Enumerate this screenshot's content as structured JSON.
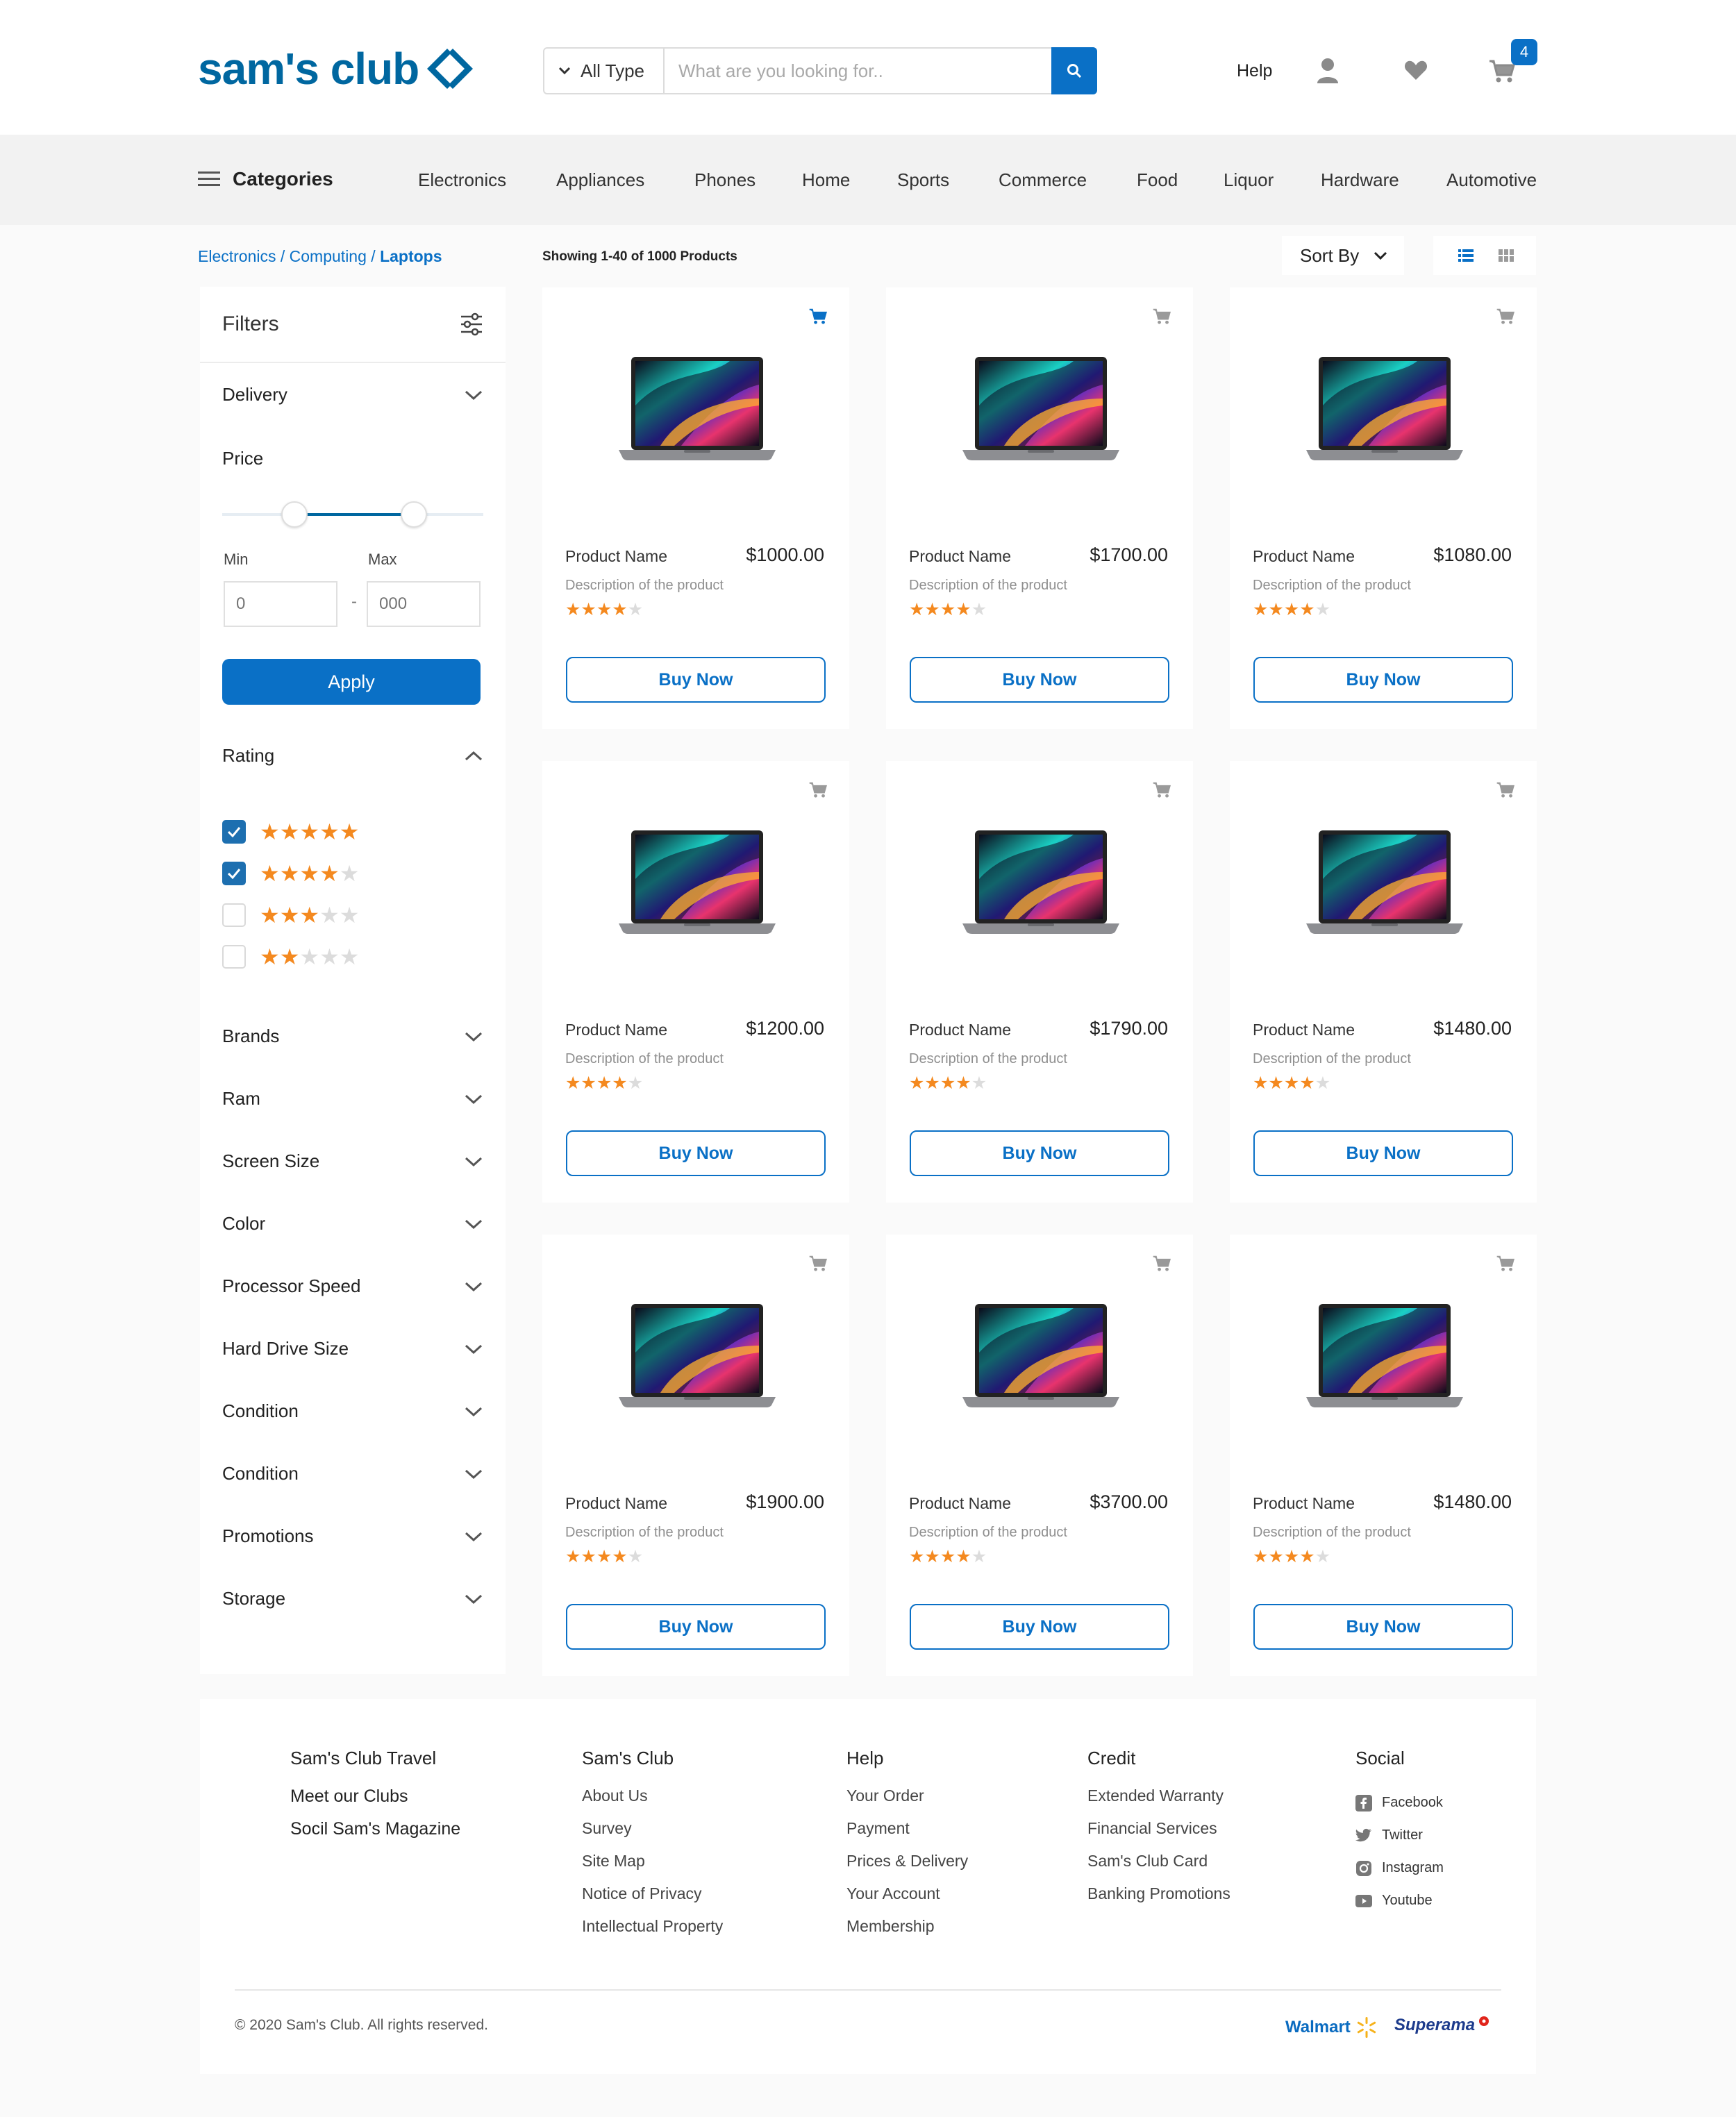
{
  "header": {
    "logo_text": "sam's club",
    "search_type": "All Type",
    "search_placeholder": "What are you looking for..",
    "help": "Help",
    "cart_count": "4"
  },
  "nav": {
    "categories_label": "Categories",
    "items": [
      "Electronics",
      "Appliances",
      "Phones",
      "Home",
      "Sports",
      "Commerce",
      "Food",
      "Liquor",
      "Hardware",
      "Automotive"
    ]
  },
  "breadcrumb": {
    "part1": "Electronics",
    "sep": " / ",
    "part2": "Computing",
    "part3": "Laptops"
  },
  "listing": {
    "showing": "Showing 1-40 of 1000 Products",
    "sort_label": "Sort By"
  },
  "filters": {
    "title": "Filters",
    "delivery": "Delivery",
    "price": "Price",
    "min_label": "Min",
    "max_label": "Max",
    "min_placeholder": "0",
    "max_placeholder": "000",
    "dash": "-",
    "apply": "Apply",
    "rating": "Rating",
    "rating_options": [
      {
        "stars": 5,
        "checked": true
      },
      {
        "stars": 4,
        "checked": true
      },
      {
        "stars": 3,
        "checked": false
      },
      {
        "stars": 2,
        "checked": false
      }
    ],
    "groups": [
      "Brands",
      "Ram",
      "Screen Size",
      "Color",
      "Processor Speed",
      "Hard Drive Size",
      "Condition",
      "Condition",
      "Promotions",
      "Storage"
    ]
  },
  "products": [
    {
      "name": "Product Name",
      "price": "$1000.00",
      "desc": "Description of the product",
      "rating": 4,
      "buy": "Buy Now",
      "cart_active": true
    },
    {
      "name": "Product Name",
      "price": "$1700.00",
      "desc": "Description of the product",
      "rating": 4,
      "buy": "Buy Now",
      "cart_active": false
    },
    {
      "name": "Product Name",
      "price": "$1080.00",
      "desc": "Description of the product",
      "rating": 4,
      "buy": "Buy Now",
      "cart_active": false
    },
    {
      "name": "Product Name",
      "price": "$1200.00",
      "desc": "Description of the product",
      "rating": 4,
      "buy": "Buy Now",
      "cart_active": false
    },
    {
      "name": "Product Name",
      "price": "$1790.00",
      "desc": "Description of the product",
      "rating": 4,
      "buy": "Buy Now",
      "cart_active": false
    },
    {
      "name": "Product Name",
      "price": "$1480.00",
      "desc": "Description of the product",
      "rating": 4,
      "buy": "Buy Now",
      "cart_active": false
    },
    {
      "name": "Product Name",
      "price": "$1900.00",
      "desc": "Description of the product",
      "rating": 4,
      "buy": "Buy Now",
      "cart_active": false
    },
    {
      "name": "Product Name",
      "price": "$3700.00",
      "desc": "Description of the product",
      "rating": 4,
      "buy": "Buy Now",
      "cart_active": false
    },
    {
      "name": "Product Name",
      "price": "$1480.00",
      "desc": "Description of the product",
      "rating": 4,
      "buy": "Buy Now",
      "cart_active": false
    }
  ],
  "footer": {
    "col1": {
      "head": "Sam's Club Travel",
      "links": [
        "Meet our Clubs",
        "Socil Sam's Magazine"
      ]
    },
    "col2": {
      "head": "Sam's Club",
      "links": [
        "About Us",
        "Survey",
        "Site Map",
        "Notice of Privacy",
        "Intellectual Property"
      ]
    },
    "col3": {
      "head": "Help",
      "links": [
        "Your Order",
        "Payment",
        "Prices & Delivery",
        "Your Account",
        "Membership"
      ]
    },
    "col4": {
      "head": "Credit",
      "links": [
        "Extended Warranty",
        "Financial Services",
        "Sam's Club Card",
        "Banking Promotions"
      ]
    },
    "col5": {
      "head": "Social",
      "links": [
        "Facebook",
        "Twitter",
        "Instagram",
        "Youtube"
      ]
    },
    "copyright": "© 2020 Sam's Club. All rights reserved.",
    "walmart": "Walmart",
    "superama": "Superama"
  },
  "colors": {
    "brand_blue": "#0067a0",
    "accent_blue": "#0a70c6",
    "star_orange": "#f4891f"
  }
}
